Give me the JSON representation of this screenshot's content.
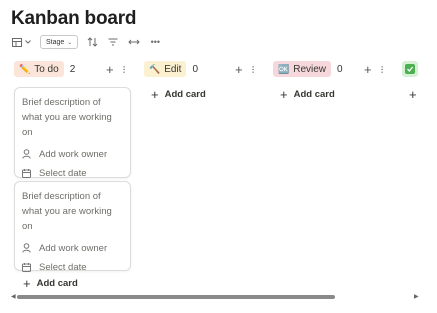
{
  "title": "Kanban board",
  "toolbar": {
    "stage_label": "Stage",
    "icons": [
      "board-view-icon",
      "chevron-down-icon",
      "sort-icon",
      "filter-icon",
      "expand-icon",
      "more-icon"
    ]
  },
  "columns": [
    {
      "label": "To do",
      "emoji": "✏️",
      "count": "2",
      "color": "#fbe4da"
    },
    {
      "label": "Edit",
      "emoji": "🔨",
      "count": "0",
      "color": "#fbf0cf"
    },
    {
      "label": "Review",
      "emoji": "🆗",
      "count": "0",
      "color": "#f6d8dc"
    }
  ],
  "cards": [
    {
      "description": "Brief description of what you are working on",
      "owner_label": "Add work owner",
      "date_label": "Select date"
    },
    {
      "description": "Brief description of what you are working on",
      "owner_label": "Add work owner",
      "date_label": "Select date"
    }
  ],
  "add_card_label": "Add card",
  "colors": {
    "done_chip": "#d6f0d6",
    "scroll_thumb": "#8a8a8a"
  }
}
